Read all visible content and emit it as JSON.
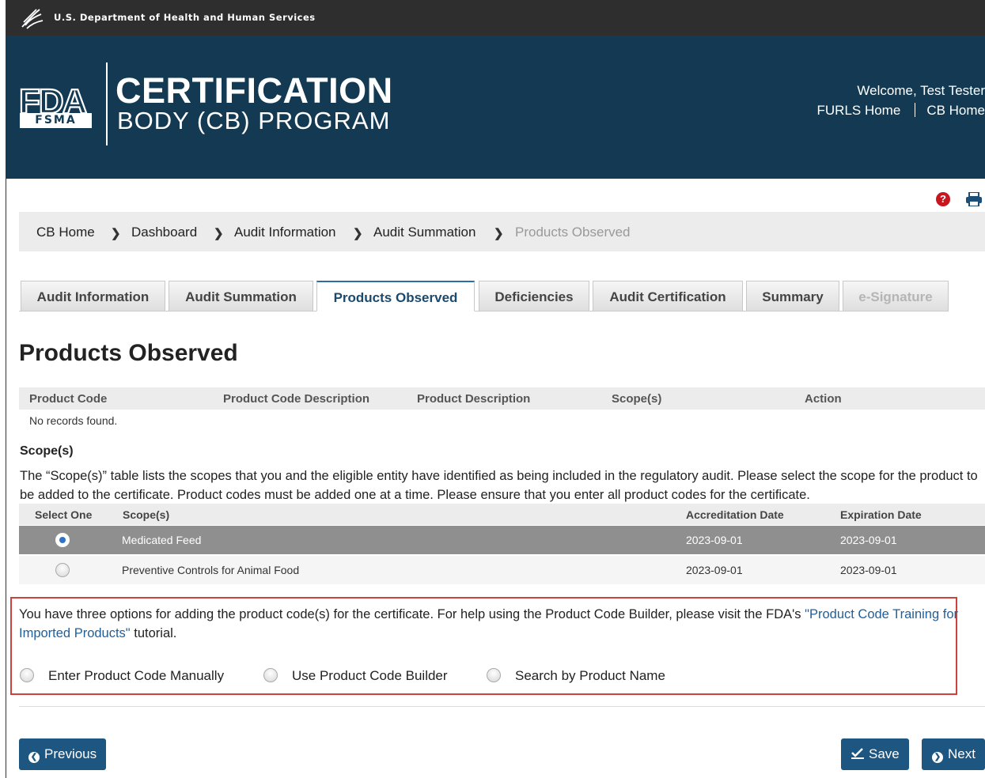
{
  "agency_bar": {
    "text": "U.S. Department of Health and Human Services"
  },
  "header": {
    "logo_fsma": "FSMA",
    "title_line1": "CERTIFICATION",
    "title_line2": "BODY (CB) PROGRAM",
    "welcome": "Welcome, Test Tester",
    "links": [
      "FURLS Home",
      "CB Home"
    ]
  },
  "breadcrumb": [
    "CB Home",
    "Dashboard",
    "Audit Information",
    "Audit Summation",
    "Products Observed"
  ],
  "tabs": [
    {
      "label": "Audit Information",
      "state": "normal"
    },
    {
      "label": "Audit Summation",
      "state": "normal"
    },
    {
      "label": "Products Observed",
      "state": "active"
    },
    {
      "label": "Deficiencies",
      "state": "normal"
    },
    {
      "label": "Audit Certification",
      "state": "normal"
    },
    {
      "label": "Summary",
      "state": "normal"
    },
    {
      "label": "e-Signature",
      "state": "disabled"
    }
  ],
  "page_title": "Products Observed",
  "products_table": {
    "columns": [
      "Product Code",
      "Product Code Description",
      "Product Description",
      "Scope(s)",
      "Action"
    ],
    "empty_message": "No records found."
  },
  "scope_section": {
    "heading": "Scope(s)",
    "description": "The “Scope(s)” table lists the scopes that you and the eligible entity have identified as being included in the regulatory audit. Please select the scope for the product to be added to the certificate. Product codes must be added one at a time. Please ensure that you enter all product codes for the certificate.",
    "columns": [
      "Select One",
      "Scope(s)",
      "Accreditation Date",
      "Expiration Date"
    ],
    "rows": [
      {
        "scope": "Medicated Feed",
        "accreditation_date": "2023-09-01",
        "expiration_date": "2023-09-01",
        "selected": true
      },
      {
        "scope": "Preventive Controls for Animal Food",
        "accreditation_date": "2023-09-01",
        "expiration_date": "2023-09-01",
        "selected": false
      }
    ]
  },
  "options": {
    "text_before": "You have three options for adding the product code(s) for the certificate. For help using the Product Code Builder, please visit the FDA's ",
    "link_text": "\"Product Code Training for Imported Products\"",
    "text_after": " tutorial.",
    "choices": [
      "Enter Product Code Manually",
      "Use Product Code Builder",
      "Search by Product Name"
    ]
  },
  "buttons": {
    "previous": "Previous",
    "save": "Save",
    "next": "Next"
  },
  "colors": {
    "header_bg": "#133a52",
    "agency_bar_bg": "#2e2e2e",
    "button_bg": "#1d5680",
    "highlight_border": "#d0403c",
    "link": "#1f5f9b"
  },
  "icons": [
    "hhs-eagle-icon",
    "help-icon",
    "print-icon",
    "chevron-right-icon",
    "chevron-left-circle-icon",
    "checkmark-icon",
    "chevron-right-circle-icon"
  ]
}
